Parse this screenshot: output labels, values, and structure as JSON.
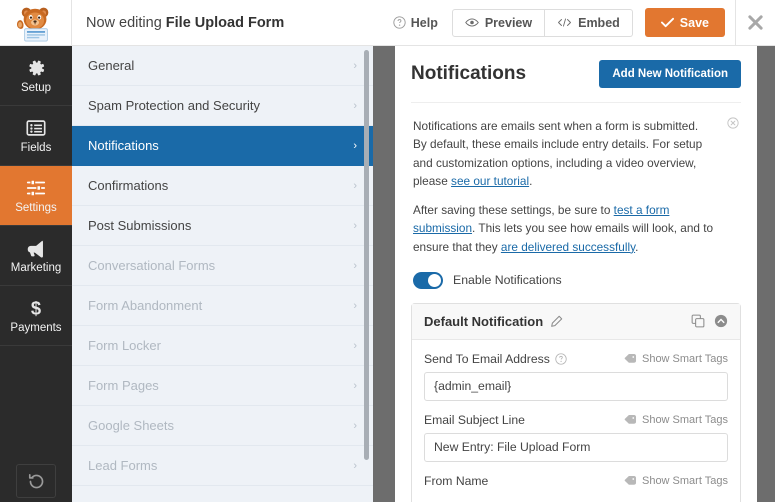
{
  "topbar": {
    "logo_icon": "wpforms-bear-logo",
    "editing_prefix": "Now editing",
    "form_name": "File Upload Form",
    "help_label": "Help",
    "help_icon": "question-circle-icon",
    "preview_label": "Preview",
    "preview_icon": "eye-icon",
    "embed_label": "Embed",
    "embed_icon": "code-icon",
    "save_label": "Save",
    "save_icon": "check-icon",
    "save_color": "#e27730",
    "close_icon": "close-icon"
  },
  "rail": {
    "items": [
      {
        "label": "Setup",
        "icon": "gear-icon",
        "active": false
      },
      {
        "label": "Fields",
        "icon": "list-icon",
        "active": false
      },
      {
        "label": "Settings",
        "icon": "sliders-icon",
        "active": true
      },
      {
        "label": "Marketing",
        "icon": "megaphone-icon",
        "active": false
      },
      {
        "label": "Payments",
        "icon": "dollar-icon",
        "active": false
      }
    ],
    "revert_icon": "revert-history-icon",
    "active_color": "#e27730"
  },
  "menu": {
    "items": [
      {
        "label": "General",
        "state": "enabled"
      },
      {
        "label": "Spam Protection and Security",
        "state": "enabled"
      },
      {
        "label": "Notifications",
        "state": "active"
      },
      {
        "label": "Confirmations",
        "state": "enabled"
      },
      {
        "label": "Post Submissions",
        "state": "enabled"
      },
      {
        "label": "Conversational Forms",
        "state": "disabled"
      },
      {
        "label": "Form Abandonment",
        "state": "disabled"
      },
      {
        "label": "Form Locker",
        "state": "disabled"
      },
      {
        "label": "Form Pages",
        "state": "disabled"
      },
      {
        "label": "Google Sheets",
        "state": "disabled"
      },
      {
        "label": "Lead Forms",
        "state": "disabled"
      }
    ],
    "arrow_icon": "chevron-right-icon",
    "active_color": "#1a6aa8"
  },
  "main": {
    "title": "Notifications",
    "add_button": "Add New Notification",
    "add_button_color": "#1a6aa8",
    "info": {
      "p1_a": "Notifications are emails sent when a form is submitted. By default, these emails include entry details. For setup and customization options, including a video overview, please ",
      "p1_link": "see our tutorial",
      "p1_b": ".",
      "p2_a": "After saving these settings, be sure to ",
      "p2_link1": "test a form submission",
      "p2_b": ". This lets you see how emails will look, and to ensure that they ",
      "p2_link2": "are delivered successfully",
      "p2_c": ".",
      "close_icon": "dismiss-icon"
    },
    "toggle": {
      "label": "Enable Notifications",
      "enabled": true
    },
    "card": {
      "title": "Default Notification",
      "edit_icon": "pencil-icon",
      "duplicate_icon": "duplicate-icon",
      "collapse_icon": "chevron-up-circle-icon",
      "fields": [
        {
          "label": "Send To Email Address",
          "help_icon": "question-circle-icon",
          "smart_tags": "Show Smart Tags",
          "smart_tags_icon": "tag-icon",
          "value": "{admin_email}"
        },
        {
          "label": "Email Subject Line",
          "help_icon": "",
          "smart_tags": "Show Smart Tags",
          "smart_tags_icon": "tag-icon",
          "value": "New Entry: File Upload Form"
        },
        {
          "label": "From Name",
          "help_icon": "",
          "smart_tags": "Show Smart Tags",
          "smart_tags_icon": "tag-icon",
          "value": ""
        }
      ]
    }
  }
}
